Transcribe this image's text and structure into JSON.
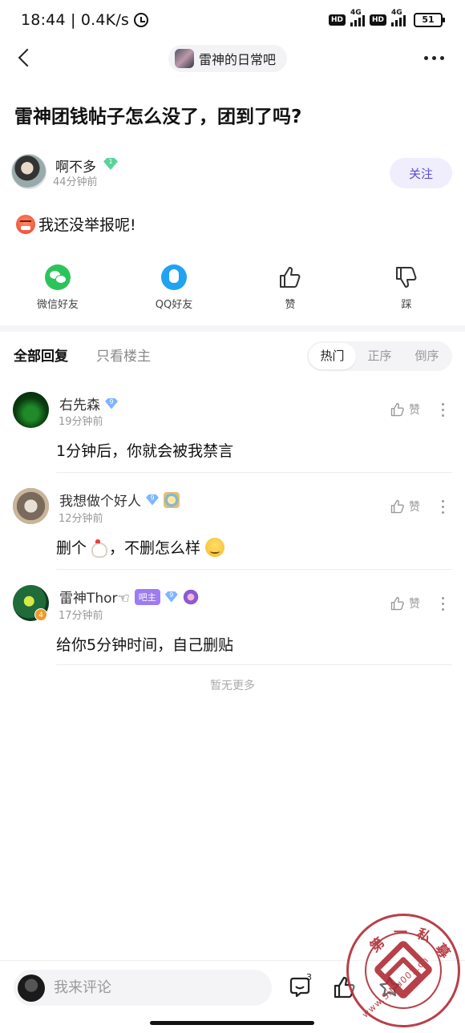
{
  "status_bar": {
    "time": "18:44",
    "net_speed": "0.4K/s",
    "sim1_badge": "HD",
    "sim1_net": "4G",
    "sim2_badge": "HD",
    "sim2_net": "4G",
    "battery": "51"
  },
  "nav": {
    "forum_name": "雷神的日常吧"
  },
  "post": {
    "title": "雷神团钱帖子怎么没了，团到了吗?",
    "author": {
      "name": "啊不多",
      "level": "1",
      "time": "44分钟前"
    },
    "follow_label": "关注",
    "body": "我还没举报呢!"
  },
  "actions": {
    "wechat": "微信好友",
    "qq": "QQ好友",
    "like": "赞",
    "dislike": "踩"
  },
  "tabs": {
    "all_replies": "全部回复",
    "op_only": "只看楼主"
  },
  "sort": {
    "options": [
      "热门",
      "正序",
      "倒序"
    ],
    "selected": "热门"
  },
  "replies": [
    {
      "name": "右先森",
      "level": "9",
      "time": "19分钟前",
      "text": "1分钟后，你就会被我禁言",
      "like": "赞"
    },
    {
      "name": "我想做个好人",
      "level": "9",
      "time": "12分钟前",
      "text_before": "删个",
      "text_after": "，不删怎么样",
      "like": "赞"
    },
    {
      "name": "雷神Thor☜",
      "tag": "吧主",
      "level": "9",
      "time": "17分钟前",
      "text": "给你5分钟时间，自己删贴",
      "like": "赞",
      "avatar_badge": "4"
    }
  ],
  "list_footer": "暂无更多",
  "bottom_bar": {
    "comment_placeholder": "我来评论",
    "comment_count": "3"
  },
  "watermark": {
    "chars": [
      "第",
      "一",
      "私",
      "募"
    ],
    "url": "www.SiMu001.cn"
  },
  "colors": {
    "accent_purple": "#5b4bd6",
    "follow_bg": "#f0eefc",
    "admin_tag": "#9d7cf2",
    "wechat_green": "#2bc45c",
    "qq_blue": "#21a2f2",
    "watermark_red": "#b2303a"
  },
  "icons": {
    "back": "chevron-left-icon",
    "more": "more-horizontal-icon",
    "like": "thumb-up-icon",
    "dislike": "thumb-down-icon",
    "comment": "comment-icon",
    "share": "share-icon"
  }
}
